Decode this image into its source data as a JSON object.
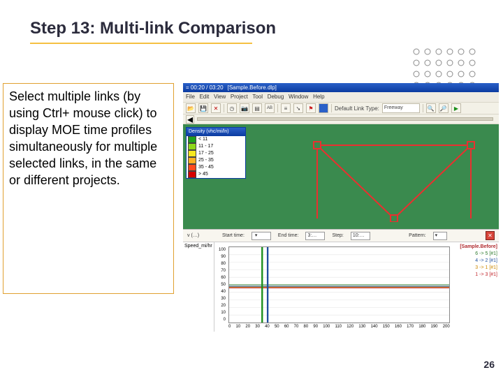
{
  "title": "Step 13: Multi-link Comparison",
  "description": "Select multiple links (by using Ctrl+ mouse click) to display MOE time profiles simultaneously for multiple selected links, in the same or different projects.",
  "page_number": "26",
  "app": {
    "titlebar_time": "= 00:20 / 03:20",
    "titlebar_file": "[Sample.Before.dlp]",
    "menus": [
      "File",
      "Edit",
      "View",
      "Project",
      "Tool",
      "Debug",
      "Window",
      "Help"
    ],
    "default_link_type_label": "Default Link Type:",
    "default_link_type_value": "Freeway"
  },
  "legend": {
    "title": "Density (vhc/mi/ln)",
    "rows": [
      {
        "color": "#1ea11e",
        "label": "< 11"
      },
      {
        "color": "#8fd91b",
        "label": "11 - 17"
      },
      {
        "color": "#f7e81e",
        "label": "17 - 25"
      },
      {
        "color": "#ffb020",
        "label": "25 - 35"
      },
      {
        "color": "#ff4a1c",
        "label": "35 - 45"
      },
      {
        "color": "#d50000",
        "label": "> 45"
      }
    ]
  },
  "profile": {
    "panel_title": "v (…)",
    "moe_name": "Speed_mi/hr",
    "start_label": "Start time:",
    "end_label": "End time:",
    "step_label": "Step:",
    "end_value": "3:…",
    "step_value": "10:…",
    "pattern_label": "Pattern:",
    "legend_header": "[Sample.Before]",
    "legend_items": [
      {
        "cls": "lg1",
        "text": "6 ->  5 [#1]"
      },
      {
        "cls": "lg2",
        "text": "4 ->  2 [#1]"
      },
      {
        "cls": "lg3",
        "text": "3 ->  1 [#1]"
      },
      {
        "cls": "lg4",
        "text": "1 ->  3 [#1]"
      }
    ]
  },
  "chart_data": {
    "type": "line",
    "title": "",
    "xlabel": "",
    "ylabel": "Speed_mi/hr",
    "xlim": [
      0,
      200
    ],
    "ylim": [
      0,
      100
    ],
    "x_ticks": [
      0,
      10,
      20,
      30,
      40,
      50,
      60,
      70,
      80,
      90,
      100,
      110,
      120,
      130,
      140,
      150,
      160,
      170,
      180,
      190,
      200
    ],
    "y_ticks": [
      0,
      10,
      20,
      30,
      40,
      50,
      60,
      70,
      80,
      90,
      100
    ],
    "x": [
      0,
      10,
      20,
      30,
      40,
      50,
      60,
      70,
      80,
      90,
      100,
      110,
      120,
      130,
      140,
      150,
      160,
      170,
      180,
      190,
      200
    ],
    "series": [
      {
        "name": "6 -> 5 [#1]",
        "color": "#2f7c2f",
        "values": [
          50,
          50,
          50,
          50,
          50,
          50,
          50,
          50,
          50,
          50,
          50,
          50,
          50,
          50,
          50,
          50,
          50,
          50,
          50,
          50,
          50
        ]
      },
      {
        "name": "4 -> 2 [#1]",
        "color": "#1e4e9e",
        "values": [
          48,
          48,
          48,
          48,
          48,
          48,
          48,
          48,
          48,
          48,
          48,
          48,
          48,
          48,
          48,
          48,
          48,
          48,
          48,
          48,
          48
        ]
      },
      {
        "name": "3 -> 1 [#1]",
        "color": "#c80",
        "values": [
          47,
          47,
          47,
          47,
          47,
          47,
          47,
          47,
          47,
          47,
          47,
          47,
          47,
          47,
          47,
          47,
          47,
          47,
          47,
          47,
          47
        ]
      },
      {
        "name": "1 -> 3 [#1]",
        "color": "#c2262b",
        "values": [
          46,
          46,
          46,
          46,
          46,
          46,
          46,
          46,
          46,
          46,
          46,
          46,
          46,
          46,
          46,
          46,
          46,
          46,
          46,
          46,
          46
        ]
      }
    ],
    "markers_x": [
      30,
      35
    ]
  }
}
